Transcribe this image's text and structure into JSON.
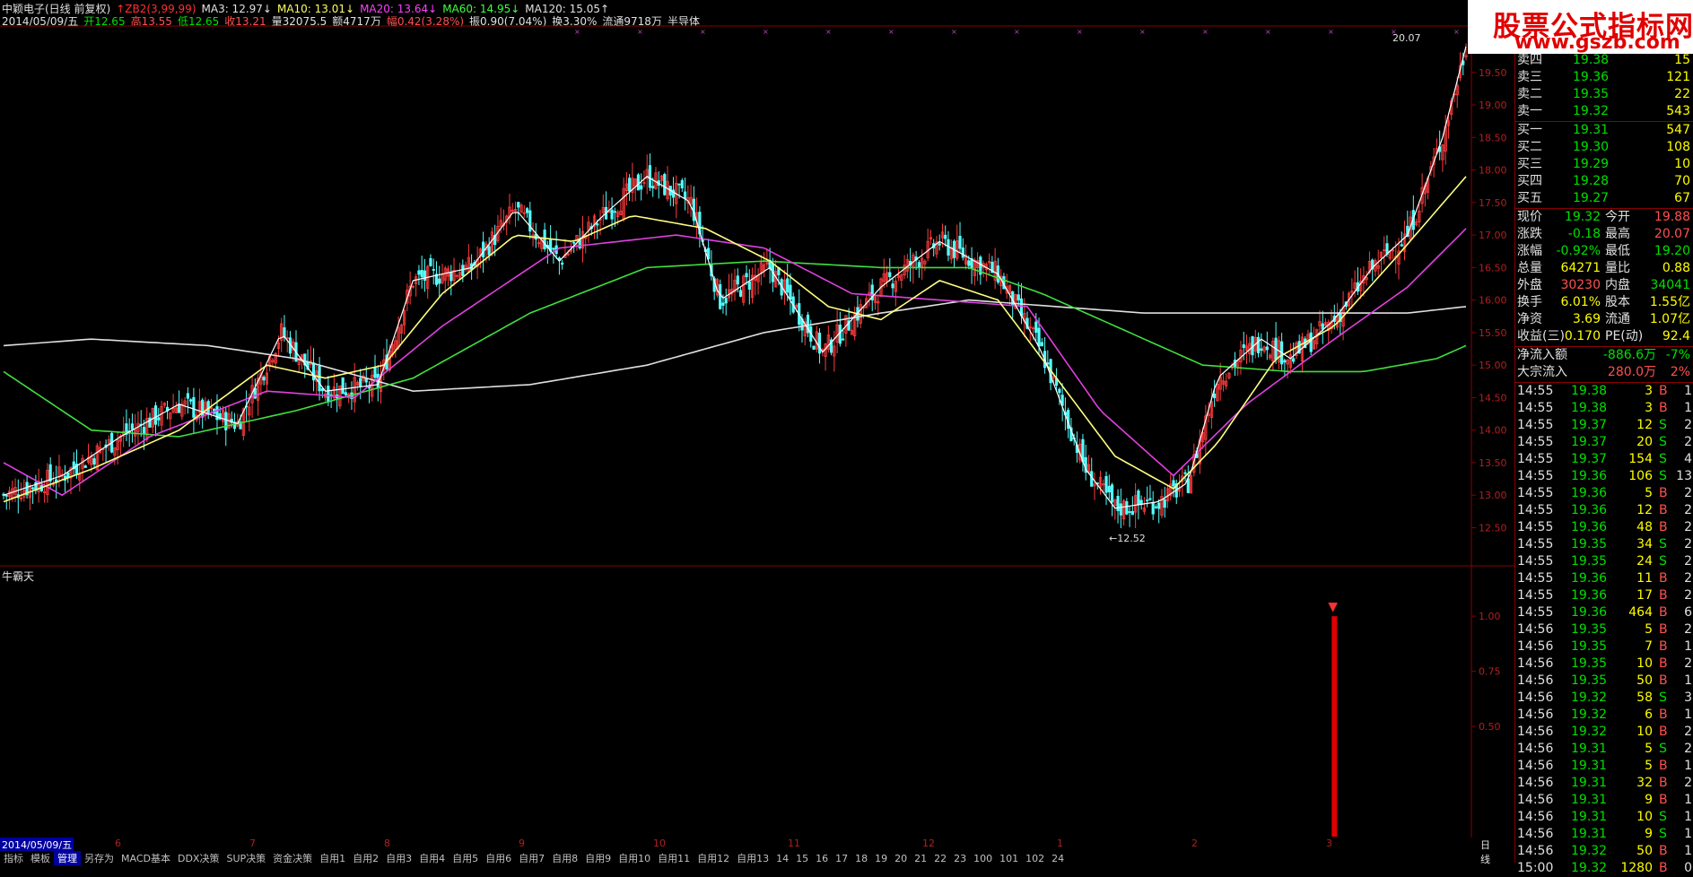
{
  "header": {
    "line1": [
      {
        "text": "中颖电子(日线 前复权)",
        "color": "#e0e0e0"
      },
      {
        "text": "↑ZB2(3,99,99)",
        "color": "#ff3030"
      },
      {
        "text": "MA3: 12.97↓",
        "color": "#e0e0e0"
      },
      {
        "text": "MA10: 13.01↓",
        "color": "#ffff60"
      },
      {
        "text": "MA20: 13.64↓",
        "color": "#ff40ff"
      },
      {
        "text": "MA60: 14.95↓",
        "color": "#40ff40"
      },
      {
        "text": "MA120: 15.05↑",
        "color": "#e0e0e0"
      }
    ],
    "line2": [
      {
        "text": "2014/05/09/五",
        "color": "#e0e0e0"
      },
      {
        "text": "开12.65",
        "color": "#00e000"
      },
      {
        "text": "高13.55",
        "color": "#ff5050"
      },
      {
        "text": "低12.65",
        "color": "#00e000"
      },
      {
        "text": "收13.21",
        "color": "#ff5050"
      },
      {
        "text": "量32075.5",
        "color": "#e0e0e0"
      },
      {
        "text": "额4717万",
        "color": "#e0e0e0"
      },
      {
        "text": "幅0.42(3.28%)",
        "color": "#ff5050"
      },
      {
        "text": "振0.90(7.04%)",
        "color": "#e0e0e0"
      },
      {
        "text": "换3.30%",
        "color": "#e0e0e0"
      },
      {
        "text": "流通9718万",
        "color": "#e0e0e0"
      },
      {
        "text": "半导体",
        "color": "#e0e0e0"
      }
    ]
  },
  "logo": {
    "title": "股票公式指标网",
    "url": "www.gszb.com"
  },
  "price_axis": [
    "19.50",
    "19.00",
    "18.50",
    "18.00",
    "17.50",
    "17.00",
    "16.50",
    "16.00",
    "15.50",
    "15.00",
    "14.50",
    "14.00",
    "13.50",
    "13.00",
    "12.50"
  ],
  "annotations": {
    "high": "20.07",
    "low": "←12.52",
    "sub_title": "牛霸天"
  },
  "sub_axis": [
    "1.00",
    "0.75",
    "0.50"
  ],
  "date_axis": {
    "current": "2014/05/09/五",
    "months": [
      "6",
      "7",
      "8",
      "9",
      "10",
      "11",
      "12",
      "1",
      "2",
      "3"
    ],
    "period": "日线"
  },
  "bottom_tabs": [
    "指标",
    "模板",
    "管理",
    "另存为",
    "MACD基本",
    "DDX决策",
    "SUP决策",
    "资金决策",
    "自用1",
    "自用2",
    "自用3",
    "自用4",
    "自用5",
    "自用6",
    "自用7",
    "自用8",
    "自用9",
    "自用10",
    "自用11",
    "自用12",
    "自用13",
    "14",
    "15",
    "16",
    "17",
    "18",
    "19",
    "20",
    "21",
    "22",
    "23",
    "100",
    "101",
    "102",
    "24"
  ],
  "quote": {
    "asks": [
      {
        "label": "卖四",
        "price": "19.38",
        "vol": "15"
      },
      {
        "label": "卖三",
        "price": "19.36",
        "vol": "121"
      },
      {
        "label": "卖二",
        "price": "19.35",
        "vol": "22"
      },
      {
        "label": "卖一",
        "price": "19.32",
        "vol": "543"
      }
    ],
    "bids": [
      {
        "label": "买一",
        "price": "19.31",
        "vol": "547"
      },
      {
        "label": "买二",
        "price": "19.30",
        "vol": "108"
      },
      {
        "label": "买三",
        "price": "19.29",
        "vol": "10"
      },
      {
        "label": "买四",
        "price": "19.28",
        "vol": "70"
      },
      {
        "label": "买五",
        "price": "19.27",
        "vol": "67"
      }
    ],
    "stats": [
      {
        "l1": "现价",
        "v1": "19.32",
        "c1": "#00e000",
        "l2": "今开",
        "v2": "19.88",
        "c2": "#ff5050"
      },
      {
        "l1": "涨跌",
        "v1": "-0.18",
        "c1": "#00e000",
        "l2": "最高",
        "v2": "20.07",
        "c2": "#ff5050"
      },
      {
        "l1": "涨幅",
        "v1": "-0.92%",
        "c1": "#00e000",
        "l2": "最低",
        "v2": "19.20",
        "c2": "#00e000"
      },
      {
        "l1": "总量",
        "v1": "64271",
        "c1": "#ffff00",
        "l2": "量比",
        "v2": "0.88",
        "c2": "#ffff00"
      },
      {
        "l1": "外盘",
        "v1": "30230",
        "c1": "#ff5050",
        "l2": "内盘",
        "v2": "34041",
        "c2": "#00e000"
      },
      {
        "l1": "换手",
        "v1": "6.01%",
        "c1": "#ffff00",
        "l2": "股本",
        "v2": "1.55亿",
        "c2": "#ffff00"
      },
      {
        "l1": "净资",
        "v1": "3.69",
        "c1": "#ffff00",
        "l2": "流通",
        "v2": "1.07亿",
        "c2": "#ffff00"
      },
      {
        "l1": "收益(三)",
        "v1": "0.170",
        "c1": "#ffff00",
        "l2": "PE(动)",
        "v2": "92.4",
        "c2": "#ffff00"
      }
    ],
    "flows": [
      {
        "label": "净流入额",
        "value": "-886.6万",
        "pct": "-7%",
        "color": "#00e000"
      },
      {
        "label": "大宗流入",
        "value": "280.0万",
        "pct": "2%",
        "color": "#ff5050"
      }
    ],
    "ticks": [
      {
        "t": "14:55",
        "p": "19.38",
        "v": "3",
        "d": "B",
        "n": "1"
      },
      {
        "t": "14:55",
        "p": "19.38",
        "v": "3",
        "d": "B",
        "n": "1"
      },
      {
        "t": "14:55",
        "p": "19.37",
        "v": "12",
        "d": "S",
        "n": "2"
      },
      {
        "t": "14:55",
        "p": "19.37",
        "v": "20",
        "d": "S",
        "n": "2"
      },
      {
        "t": "14:55",
        "p": "19.37",
        "v": "154",
        "d": "S",
        "n": "4"
      },
      {
        "t": "14:55",
        "p": "19.36",
        "v": "106",
        "d": "S",
        "n": "13"
      },
      {
        "t": "14:55",
        "p": "19.36",
        "v": "5",
        "d": "B",
        "n": "2"
      },
      {
        "t": "14:55",
        "p": "19.36",
        "v": "12",
        "d": "B",
        "n": "2"
      },
      {
        "t": "14:55",
        "p": "19.36",
        "v": "48",
        "d": "B",
        "n": "2"
      },
      {
        "t": "14:55",
        "p": "19.35",
        "v": "34",
        "d": "S",
        "n": "2"
      },
      {
        "t": "14:55",
        "p": "19.35",
        "v": "24",
        "d": "S",
        "n": "2"
      },
      {
        "t": "14:55",
        "p": "19.36",
        "v": "11",
        "d": "B",
        "n": "2"
      },
      {
        "t": "14:55",
        "p": "19.36",
        "v": "17",
        "d": "B",
        "n": "2"
      },
      {
        "t": "14:55",
        "p": "19.36",
        "v": "464",
        "d": "B",
        "n": "6"
      },
      {
        "t": "14:56",
        "p": "19.35",
        "v": "5",
        "d": "B",
        "n": "2"
      },
      {
        "t": "14:56",
        "p": "19.35",
        "v": "7",
        "d": "B",
        "n": "1"
      },
      {
        "t": "14:56",
        "p": "19.35",
        "v": "10",
        "d": "B",
        "n": "2"
      },
      {
        "t": "14:56",
        "p": "19.35",
        "v": "50",
        "d": "B",
        "n": "1"
      },
      {
        "t": "14:56",
        "p": "19.32",
        "v": "58",
        "d": "S",
        "n": "3"
      },
      {
        "t": "14:56",
        "p": "19.32",
        "v": "6",
        "d": "B",
        "n": "1"
      },
      {
        "t": "14:56",
        "p": "19.32",
        "v": "10",
        "d": "B",
        "n": "2"
      },
      {
        "t": "14:56",
        "p": "19.31",
        "v": "5",
        "d": "S",
        "n": "2"
      },
      {
        "t": "14:56",
        "p": "19.31",
        "v": "5",
        "d": "B",
        "n": "1"
      },
      {
        "t": "14:56",
        "p": "19.31",
        "v": "32",
        "d": "B",
        "n": "2"
      },
      {
        "t": "14:56",
        "p": "19.31",
        "v": "9",
        "d": "B",
        "n": "1"
      },
      {
        "t": "14:56",
        "p": "19.31",
        "v": "10",
        "d": "S",
        "n": "1"
      },
      {
        "t": "14:56",
        "p": "19.31",
        "v": "9",
        "d": "S",
        "n": "1"
      },
      {
        "t": "14:56",
        "p": "19.32",
        "v": "50",
        "d": "B",
        "n": "1"
      },
      {
        "t": "15:00",
        "p": "19.32",
        "v": "1280",
        "d": "B",
        "n": "0"
      }
    ]
  },
  "chart_data": {
    "type": "candlestick",
    "price_range": [
      12.3,
      20.2
    ],
    "candles": [],
    "ma_colors": {
      "MA3": "#e0e0e0",
      "MA10": "#ffff80",
      "MA20": "#ff40ff",
      "MA60": "#40e040",
      "MA120": "#e0e0e0"
    },
    "anchors": {
      "close": [
        [
          0,
          13.0
        ],
        [
          20,
          13.3
        ],
        [
          40,
          13.9
        ],
        [
          60,
          14.4
        ],
        [
          80,
          14.1
        ],
        [
          95,
          15.5
        ],
        [
          110,
          14.6
        ],
        [
          128,
          14.7
        ],
        [
          140,
          16.3
        ],
        [
          160,
          16.5
        ],
        [
          175,
          17.4
        ],
        [
          190,
          16.6
        ],
        [
          205,
          17.3
        ],
        [
          220,
          17.9
        ],
        [
          235,
          17.5
        ],
        [
          245,
          16.0
        ],
        [
          262,
          16.5
        ],
        [
          280,
          15.2
        ],
        [
          300,
          16.2
        ],
        [
          320,
          16.9
        ],
        [
          340,
          16.4
        ],
        [
          355,
          15.2
        ],
        [
          370,
          13.4
        ],
        [
          380,
          12.8
        ],
        [
          395,
          12.9
        ],
        [
          405,
          13.2
        ],
        [
          415,
          14.8
        ],
        [
          430,
          15.4
        ],
        [
          440,
          15.1
        ],
        [
          455,
          15.7
        ],
        [
          468,
          16.5
        ],
        [
          480,
          17.0
        ],
        [
          492,
          18.5
        ],
        [
          500,
          19.9
        ]
      ],
      "ma10": [
        [
          0,
          12.9
        ],
        [
          30,
          13.4
        ],
        [
          60,
          14.0
        ],
        [
          90,
          15.0
        ],
        [
          110,
          14.8
        ],
        [
          130,
          15.0
        ],
        [
          150,
          16.1
        ],
        [
          175,
          17.0
        ],
        [
          195,
          16.9
        ],
        [
          215,
          17.3
        ],
        [
          240,
          17.1
        ],
        [
          262,
          16.6
        ],
        [
          282,
          15.9
        ],
        [
          300,
          15.7
        ],
        [
          320,
          16.3
        ],
        [
          340,
          16.0
        ],
        [
          360,
          14.8
        ],
        [
          380,
          13.6
        ],
        [
          400,
          13.1
        ],
        [
          415,
          13.8
        ],
        [
          435,
          15.1
        ],
        [
          455,
          15.6
        ],
        [
          475,
          16.6
        ],
        [
          500,
          17.9
        ]
      ],
      "ma20": [
        [
          0,
          13.5
        ],
        [
          20,
          13.0
        ],
        [
          50,
          13.9
        ],
        [
          90,
          14.6
        ],
        [
          120,
          14.5
        ],
        [
          150,
          15.6
        ],
        [
          190,
          16.8
        ],
        [
          230,
          17.0
        ],
        [
          260,
          16.8
        ],
        [
          290,
          16.1
        ],
        [
          320,
          16.0
        ],
        [
          350,
          15.9
        ],
        [
          375,
          14.3
        ],
        [
          400,
          13.3
        ],
        [
          425,
          14.4
        ],
        [
          455,
          15.4
        ],
        [
          480,
          16.2
        ],
        [
          500,
          17.1
        ]
      ],
      "ma60": [
        [
          0,
          14.9
        ],
        [
          30,
          14.0
        ],
        [
          60,
          13.9
        ],
        [
          100,
          14.3
        ],
        [
          140,
          14.8
        ],
        [
          180,
          15.8
        ],
        [
          220,
          16.5
        ],
        [
          260,
          16.6
        ],
        [
          300,
          16.5
        ],
        [
          330,
          16.5
        ],
        [
          355,
          16.1
        ],
        [
          380,
          15.6
        ],
        [
          410,
          15.0
        ],
        [
          440,
          14.9
        ],
        [
          465,
          14.9
        ],
        [
          490,
          15.1
        ],
        [
          500,
          15.3
        ]
      ],
      "ma120": [
        [
          0,
          15.3
        ],
        [
          30,
          15.4
        ],
        [
          70,
          15.3
        ],
        [
          100,
          15.1
        ],
        [
          140,
          14.6
        ],
        [
          180,
          14.7
        ],
        [
          220,
          15.0
        ],
        [
          260,
          15.5
        ],
        [
          300,
          15.8
        ],
        [
          330,
          16.0
        ],
        [
          360,
          15.9
        ],
        [
          390,
          15.8
        ],
        [
          420,
          15.8
        ],
        [
          450,
          15.8
        ],
        [
          480,
          15.8
        ],
        [
          500,
          15.9
        ]
      ]
    },
    "sub_indicator": {
      "title": "牛霸天",
      "range": [
        0,
        1.2
      ],
      "signal_index": 455,
      "signal_value": 1.0
    }
  }
}
